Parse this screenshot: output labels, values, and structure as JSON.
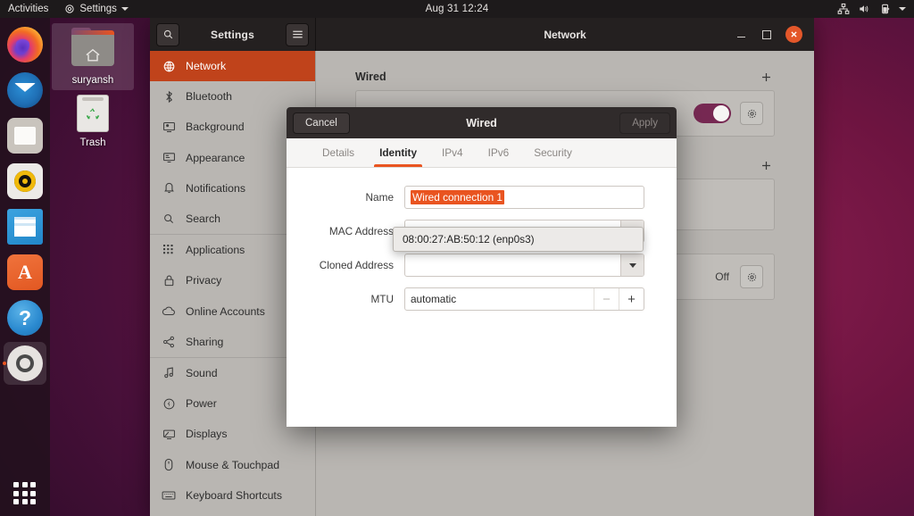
{
  "topbar": {
    "activities": "Activities",
    "app_menu": "Settings",
    "clock": "Aug 31  12:24",
    "icons": [
      "network-wired-icon",
      "volume-icon",
      "battery-icon",
      "caret-down-icon"
    ]
  },
  "dock": {
    "items": [
      {
        "name": "firefox",
        "label": "Firefox"
      },
      {
        "name": "thunderbird",
        "label": "Thunderbird Mail"
      },
      {
        "name": "files",
        "label": "Files"
      },
      {
        "name": "rhythmbox",
        "label": "Rhythmbox"
      },
      {
        "name": "libreoffice-writer",
        "label": "LibreOffice Writer"
      },
      {
        "name": "ubuntu-software",
        "label": "Ubuntu Software",
        "glyph": "A"
      },
      {
        "name": "help",
        "label": "Help",
        "glyph": "?"
      },
      {
        "name": "settings",
        "label": "Settings",
        "running": true
      }
    ],
    "show_apps_label": "Show Applications"
  },
  "desktop": {
    "icons": [
      {
        "label": "suryansh",
        "type": "home-folder",
        "selected": true
      },
      {
        "label": "Trash",
        "type": "trash",
        "selected": false
      }
    ]
  },
  "settings_window": {
    "sidebar_title": "Settings",
    "main_title": "Network",
    "search_icon": "search-icon",
    "menu_icon": "hamburger-menu-icon",
    "window_controls": {
      "minimize": "minimize-icon",
      "maximize": "maximize-icon",
      "close": "close-icon"
    },
    "sidebar_items": [
      {
        "label": "Network",
        "icon": "network-globe-icon",
        "active": true,
        "sep_after": false
      },
      {
        "label": "Bluetooth",
        "icon": "bluetooth-icon",
        "active": false,
        "sep_after": false
      },
      {
        "label": "Background",
        "icon": "background-icon",
        "active": false,
        "sep_after": false
      },
      {
        "label": "Appearance",
        "icon": "appearance-icon",
        "active": false,
        "sep_after": false
      },
      {
        "label": "Notifications",
        "icon": "notifications-bell-icon",
        "active": false,
        "sep_after": false
      },
      {
        "label": "Search",
        "icon": "search-icon",
        "active": false,
        "sep_after": true
      },
      {
        "label": "Applications",
        "icon": "applications-grid-icon",
        "active": false,
        "sep_after": false
      },
      {
        "label": "Privacy",
        "icon": "privacy-lock-icon",
        "active": false,
        "sep_after": false
      },
      {
        "label": "Online Accounts",
        "icon": "cloud-icon",
        "active": false,
        "sep_after": false
      },
      {
        "label": "Sharing",
        "icon": "sharing-icon",
        "active": false,
        "sep_after": true
      },
      {
        "label": "Sound",
        "icon": "sound-note-icon",
        "active": false,
        "sep_after": false
      },
      {
        "label": "Power",
        "icon": "power-icon",
        "active": false,
        "sep_after": false
      },
      {
        "label": "Displays",
        "icon": "displays-icon",
        "active": false,
        "sep_after": false
      },
      {
        "label": "Mouse & Touchpad",
        "icon": "mouse-icon",
        "active": false,
        "sep_after": false
      },
      {
        "label": "Keyboard Shortcuts",
        "icon": "keyboard-icon",
        "active": false,
        "sep_after": false
      }
    ]
  },
  "network_page": {
    "section_wired_title": "Wired",
    "add_icon": "plus-icon",
    "wired_toggle_state": "on",
    "wired_settings_icon": "gear-icon",
    "vpn_add_icon": "plus-icon",
    "proxy_status": "Off",
    "proxy_settings_icon": "gear-icon"
  },
  "wired_dialog": {
    "cancel_label": "Cancel",
    "title": "Wired",
    "apply_label": "Apply",
    "apply_enabled": false,
    "tabs": [
      {
        "label": "Details",
        "active": false
      },
      {
        "label": "Identity",
        "active": true
      },
      {
        "label": "IPv4",
        "active": false
      },
      {
        "label": "IPv6",
        "active": false
      },
      {
        "label": "Security",
        "active": false
      }
    ],
    "fields": {
      "name_label": "Name",
      "name_value": "Wired connection 1",
      "name_selected": true,
      "mac_label": "MAC Address",
      "mac_value": "",
      "mac_dropdown_icon": "chevron-down-icon",
      "cloned_label": "Cloned Address",
      "cloned_value": "",
      "mtu_label": "MTU",
      "mtu_value": "automatic",
      "mtu_minus": "−",
      "mtu_plus": "+"
    },
    "mac_dropdown_options": [
      "08:00:27:AB:50:12 (enp0s3)"
    ]
  }
}
